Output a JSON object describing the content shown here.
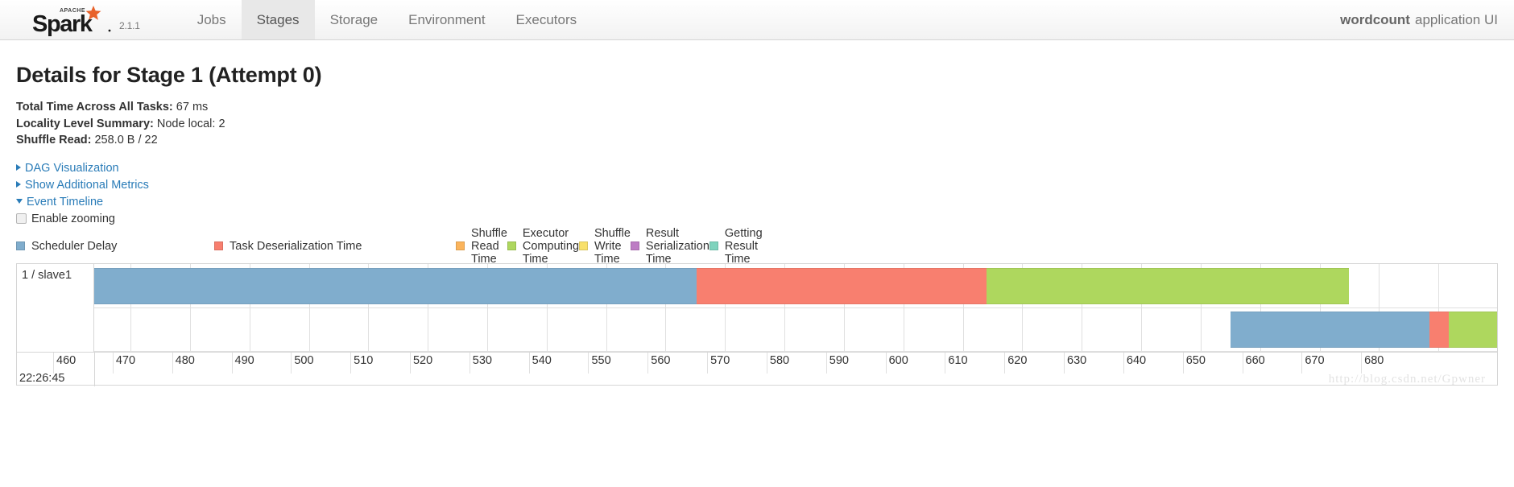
{
  "navbar": {
    "logo_text": "Spark",
    "logo_apache": "APACHE",
    "version": "2.1.1",
    "links": [
      {
        "label": "Jobs",
        "active": false
      },
      {
        "label": "Stages",
        "active": true
      },
      {
        "label": "Storage",
        "active": false
      },
      {
        "label": "Environment",
        "active": false
      },
      {
        "label": "Executors",
        "active": false
      }
    ],
    "app_name": "wordcount",
    "app_suffix": "application UI"
  },
  "page": {
    "title": "Details for Stage 1 (Attempt 0)",
    "summary": [
      {
        "label": "Total Time Across All Tasks:",
        "value": "67 ms"
      },
      {
        "label": "Locality Level Summary:",
        "value": "Node local: 2"
      },
      {
        "label": "Shuffle Read:",
        "value": "258.0 B / 22"
      }
    ],
    "toggles": [
      {
        "label": "DAG Visualization",
        "expanded": false
      },
      {
        "label": "Show Additional Metrics",
        "expanded": false
      },
      {
        "label": "Event Timeline",
        "expanded": true
      }
    ],
    "zoom_checkbox_label": "Enable zooming",
    "zoom_checked": false,
    "watermark": "http://blog.csdn.net/Gpwner"
  },
  "legend": [
    {
      "label": "Scheduler Delay",
      "color": "#80adcd"
    },
    {
      "label": "Task Deserialization Time",
      "color": "#f87f6f"
    },
    {
      "label": "Shuffle Read Time",
      "color": "#fbb45c"
    },
    {
      "label": "Executor Computing Time",
      "color": "#aed75e"
    },
    {
      "label": "Shuffle Write Time",
      "color": "#f8e06b"
    },
    {
      "label": "Result Serialization Time",
      "color": "#bd7cc4"
    },
    {
      "label": "Getting Result Time",
      "color": "#7fd3bd"
    }
  ],
  "chart_data": {
    "type": "timeline",
    "title": "Event Timeline",
    "xlabel": "",
    "ylabel": "",
    "origin_label": "22:26:45",
    "x_unit": "ms",
    "xlim": [
      453.9,
      690.0
    ],
    "ticks": [
      460,
      470,
      480,
      490,
      500,
      510,
      520,
      530,
      540,
      550,
      560,
      570,
      580,
      590,
      600,
      610,
      620,
      630,
      640,
      650,
      660,
      670,
      680
    ],
    "grid": true,
    "lanes": [
      {
        "label": "1 / slave1"
      },
      {
        "label": ""
      }
    ],
    "tasks": [
      {
        "lane": 0,
        "start": 453.9,
        "end": 665.0,
        "segments": [
          {
            "name": "Scheduler Delay",
            "start": 453.9,
            "end": 555.2,
            "color": "#80adcd"
          },
          {
            "name": "Task Deserialization Time",
            "start": 555.2,
            "end": 604.0,
            "color": "#f87f6f"
          },
          {
            "name": "Executor Computing Time",
            "start": 604.0,
            "end": 665.0,
            "color": "#aed75e"
          }
        ]
      },
      {
        "lane": 1,
        "start": 645.0,
        "end": 690.0,
        "segments": [
          {
            "name": "Scheduler Delay",
            "start": 645.0,
            "end": 678.5,
            "color": "#80adcd"
          },
          {
            "name": "Task Deserialization Time",
            "start": 678.5,
            "end": 681.7,
            "color": "#f87f6f"
          },
          {
            "name": "Executor Computing Time",
            "start": 681.7,
            "end": 690.0,
            "color": "#aed75e"
          }
        ]
      }
    ]
  }
}
